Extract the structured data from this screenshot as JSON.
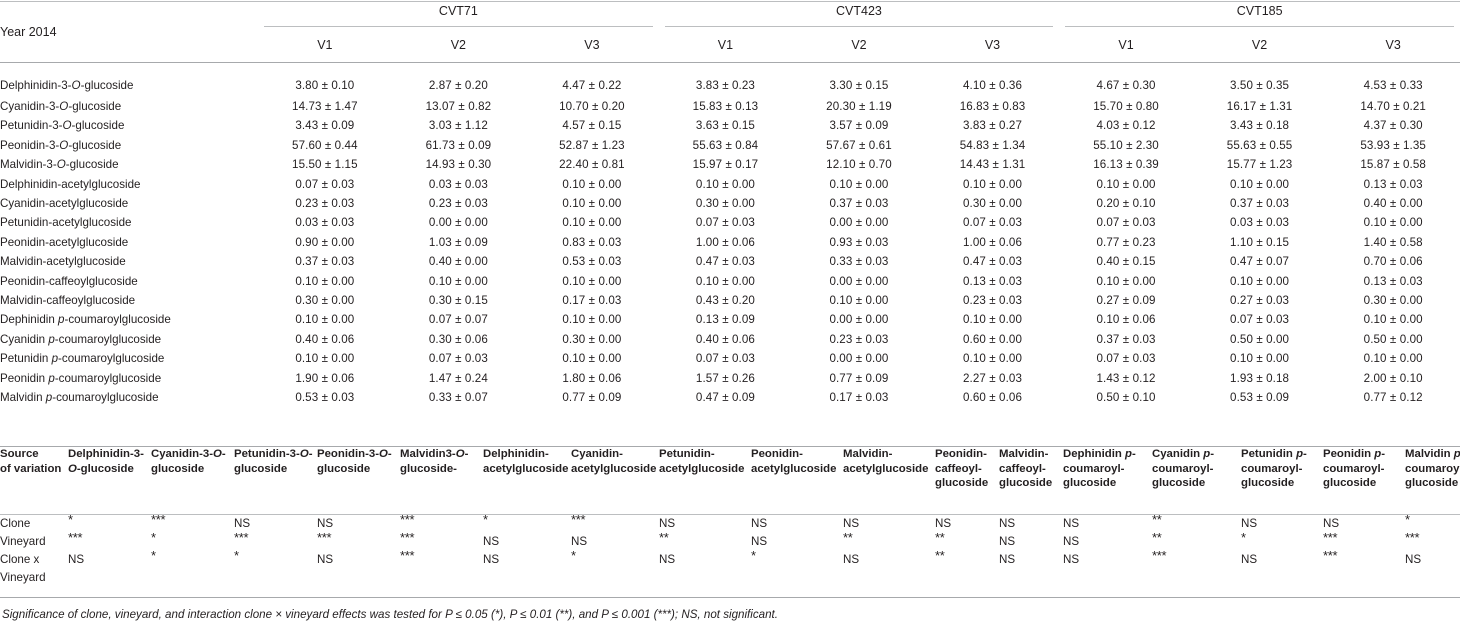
{
  "table": {
    "year_label": "Year 2014",
    "groups": [
      {
        "name": "CVT71",
        "subcolumns": [
          "V1",
          "V2",
          "V3"
        ]
      },
      {
        "name": "CVT423",
        "subcolumns": [
          "V1",
          "V2",
          "V3"
        ]
      },
      {
        "name": "CVT185",
        "subcolumns": [
          "V1",
          "V2",
          "V3"
        ]
      }
    ],
    "rows": [
      {
        "compound": "Delphinidin-3-O-glucoside",
        "italic_part": "O",
        "values": [
          "3.80 ± 0.10",
          "2.87 ± 0.20",
          "4.47 ± 0.22",
          "3.83 ± 0.23",
          "3.30 ± 0.15",
          "4.10 ± 0.36",
          "4.67 ± 0.30",
          "3.50 ± 0.35",
          "4.53 ± 0.33"
        ]
      },
      {
        "compound": "Cyanidin-3-O-glucoside",
        "italic_part": "O",
        "values": [
          "14.73 ± 1.47",
          "13.07 ± 0.82",
          "10.70 ± 0.20",
          "15.83 ± 0.13",
          "20.30 ± 1.19",
          "16.83 ± 0.83",
          "15.70 ± 0.80",
          "16.17 ± 1.31",
          "14.70 ± 0.21"
        ]
      },
      {
        "compound": "Petunidin-3-O-glucoside",
        "italic_part": "O",
        "values": [
          "3.43 ± 0.09",
          "3.03 ± 1.12",
          "4.57 ± 0.15",
          "3.63 ± 0.15",
          "3.57 ± 0.09",
          "3.83 ± 0.27",
          "4.03 ± 0.12",
          "3.43 ± 0.18",
          "4.37 ± 0.30"
        ]
      },
      {
        "compound": "Peonidin-3-O-glucoside",
        "italic_part": "O",
        "values": [
          "57.60 ± 0.44",
          "61.73 ± 0.09",
          "52.87 ± 1.23",
          "55.63 ± 0.84",
          "57.67 ± 0.61",
          "54.83 ± 1.34",
          "55.10 ± 2.30",
          "55.63 ± 0.55",
          "53.93 ± 1.35"
        ]
      },
      {
        "compound": "Malvidin-3-O-glucoside",
        "italic_part": "O",
        "values": [
          "15.50 ± 1.15",
          "14.93 ± 0.30",
          "22.40 ± 0.81",
          "15.97 ± 0.17",
          "12.10 ± 0.70",
          "14.43 ± 1.31",
          "16.13 ± 0.39",
          "15.77 ± 1.23",
          "15.87 ± 0.58"
        ]
      },
      {
        "compound": "Delphinidin-acetylglucoside",
        "italic_part": "",
        "values": [
          "0.07 ± 0.03",
          "0.03 ± 0.03",
          "0.10 ± 0.00",
          "0.10 ± 0.00",
          "0.10 ± 0.00",
          "0.10 ± 0.00",
          "0.10 ± 0.00",
          "0.10 ± 0.00",
          "0.13 ± 0.03"
        ]
      },
      {
        "compound": "Cyanidin-acetylglucoside",
        "italic_part": "",
        "values": [
          "0.23 ± 0.03",
          "0.23 ± 0.03",
          "0.10 ± 0.00",
          "0.30 ± 0.00",
          "0.37 ± 0.03",
          "0.30 ± 0.00",
          "0.20 ± 0.10",
          "0.37 ± 0.03",
          "0.40 ± 0.00"
        ]
      },
      {
        "compound": "Petunidin-acetylglucoside",
        "italic_part": "",
        "values": [
          "0.03 ± 0.03",
          "0.00 ± 0.00",
          "0.10 ± 0.00",
          "0.07 ± 0.03",
          "0.00 ± 0.00",
          "0.07 ± 0.03",
          "0.07 ± 0.03",
          "0.03 ± 0.03",
          "0.10 ± 0.00"
        ]
      },
      {
        "compound": "Peonidin-acetylglucoside",
        "italic_part": "",
        "values": [
          "0.90 ± 0.00",
          "1.03 ± 0.09",
          "0.83 ± 0.03",
          "1.00 ± 0.06",
          "0.93 ± 0.03",
          "1.00 ± 0.06",
          "0.77 ± 0.23",
          "1.10 ± 0.15",
          "1.40 ± 0.58"
        ]
      },
      {
        "compound": "Malvidin-acetylglucoside",
        "italic_part": "",
        "values": [
          "0.37 ± 0.03",
          "0.40 ± 0.00",
          "0.53 ± 0.03",
          "0.47 ± 0.03",
          "0.33 ± 0.03",
          "0.47 ± 0.03",
          "0.40 ± 0.15",
          "0.47 ± 0.07",
          "0.70 ± 0.06"
        ]
      },
      {
        "compound": "Peonidin-caffeoylglucoside",
        "italic_part": "",
        "values": [
          "0.10 ± 0.00",
          "0.10 ± 0.00",
          "0.10 ± 0.00",
          "0.10 ± 0.00",
          "0.00 ± 0.00",
          "0.13 ± 0.03",
          "0.10 ± 0.00",
          "0.10 ± 0.00",
          "0.13 ± 0.03"
        ]
      },
      {
        "compound": "Malvidin-caffeoylglucoside",
        "italic_part": "",
        "values": [
          "0.30 ± 0.00",
          "0.30 ± 0.15",
          "0.17 ± 0.03",
          "0.43 ± 0.20",
          "0.10 ± 0.00",
          "0.23 ± 0.03",
          "0.27 ± 0.09",
          "0.27 ± 0.03",
          "0.30 ± 0.00"
        ]
      },
      {
        "compound": "Dephinidin p-coumaroylglucoside",
        "italic_part": "p",
        "values": [
          "0.10 ± 0.00",
          "0.07 ± 0.07",
          "0.10 ± 0.00",
          "0.13 ± 0.09",
          "0.00 ± 0.00",
          "0.10 ± 0.00",
          "0.10 ± 0.06",
          "0.07 ± 0.03",
          "0.10 ± 0.00"
        ]
      },
      {
        "compound": "Cyanidin p-coumaroylglucoside",
        "italic_part": "p",
        "values": [
          "0.40 ± 0.06",
          "0.30 ± 0.06",
          "0.30 ± 0.00",
          "0.40 ± 0.06",
          "0.23 ± 0.03",
          "0.60 ± 0.00",
          "0.37 ± 0.03",
          "0.50 ± 0.00",
          "0.50 ± 0.00"
        ]
      },
      {
        "compound": "Petunidin p-coumaroylglucoside",
        "italic_part": "p",
        "values": [
          "0.10 ± 0.00",
          "0.07 ± 0.03",
          "0.10 ± 0.00",
          "0.07 ± 0.03",
          "0.00 ± 0.00",
          "0.10 ± 0.00",
          "0.07 ± 0.03",
          "0.10 ± 0.00",
          "0.10 ± 0.00"
        ]
      },
      {
        "compound": "Peonidin p-coumaroylglucoside",
        "italic_part": "p",
        "values": [
          "1.90 ± 0.06",
          "1.47 ± 0.24",
          "1.80 ± 0.06",
          "1.57 ± 0.26",
          "0.77 ± 0.09",
          "2.27 ± 0.03",
          "1.43 ± 0.12",
          "1.93 ± 0.18",
          "2.00 ± 0.10"
        ]
      },
      {
        "compound": "Malvidin p-coumaroylglucoside",
        "italic_part": "p",
        "values": [
          "0.53 ± 0.03",
          "0.33 ± 0.07",
          "0.77 ± 0.09",
          "0.47 ± 0.09",
          "0.17 ± 0.03",
          "0.60 ± 0.06",
          "0.50 ± 0.10",
          "0.53 ± 0.09",
          "0.77 ± 0.12"
        ]
      }
    ]
  },
  "significance": {
    "row_header": "Source of variation",
    "columns": [
      "Delphinidin-3-O-glucoside",
      "Cyanidin-3-O-glucoside",
      "Petunidin-3-O-glucoside",
      "Peonidin-3-O-glucoside",
      "Malvidin3-O-glucoside-",
      "Delphinidin-acetylglucoside",
      "Cyanidin-acetylglucoside",
      "Petunidin-acetylglucoside",
      "Peonidin-acetylglucoside",
      "Malvidin-acetylglucoside",
      "Peonidin-caffeoyl-glucoside",
      "Malvidin-caffeoyl-glucoside",
      "Dephinidin p-coumaroyl-glucoside",
      "Cyanidin p-coumaroyl-glucoside",
      "Petunidin p-coumaroyl-glucoside",
      "Peonidin p-coumaroyl-glucoside",
      "Malvidin p- coumaroyl-glucoside"
    ],
    "rows": [
      {
        "label": "Clone",
        "values": [
          "*",
          "***",
          "NS",
          "NS",
          "***",
          "*",
          "***",
          "NS",
          "NS",
          "NS",
          "NS",
          "NS",
          "NS",
          "**",
          "NS",
          "NS",
          "*"
        ]
      },
      {
        "label": "Vineyard",
        "values": [
          "***",
          "*",
          "***",
          "***",
          "***",
          "NS",
          "NS",
          "**",
          "NS",
          "**",
          "**",
          "NS",
          "NS",
          "**",
          "*",
          "***",
          "***"
        ]
      },
      {
        "label": "Clone x Vineyard",
        "values": [
          "NS",
          "*",
          "*",
          "NS",
          "***",
          "NS",
          "*",
          "NS",
          "*",
          "NS",
          "**",
          "NS",
          "NS",
          "***",
          "NS",
          "***",
          "NS"
        ]
      }
    ]
  },
  "footnote": "Significance of clone, vineyard, and interaction clone × vineyard effects was tested for P ≤ 0.05 (*), P ≤ 0.01 (**), and P ≤ 0.001 (***); NS, not significant.",
  "colors": {
    "text": "#231f20",
    "rule": "#a7a9ac",
    "rule_light": "#bcbec0",
    "background": "#ffffff"
  }
}
